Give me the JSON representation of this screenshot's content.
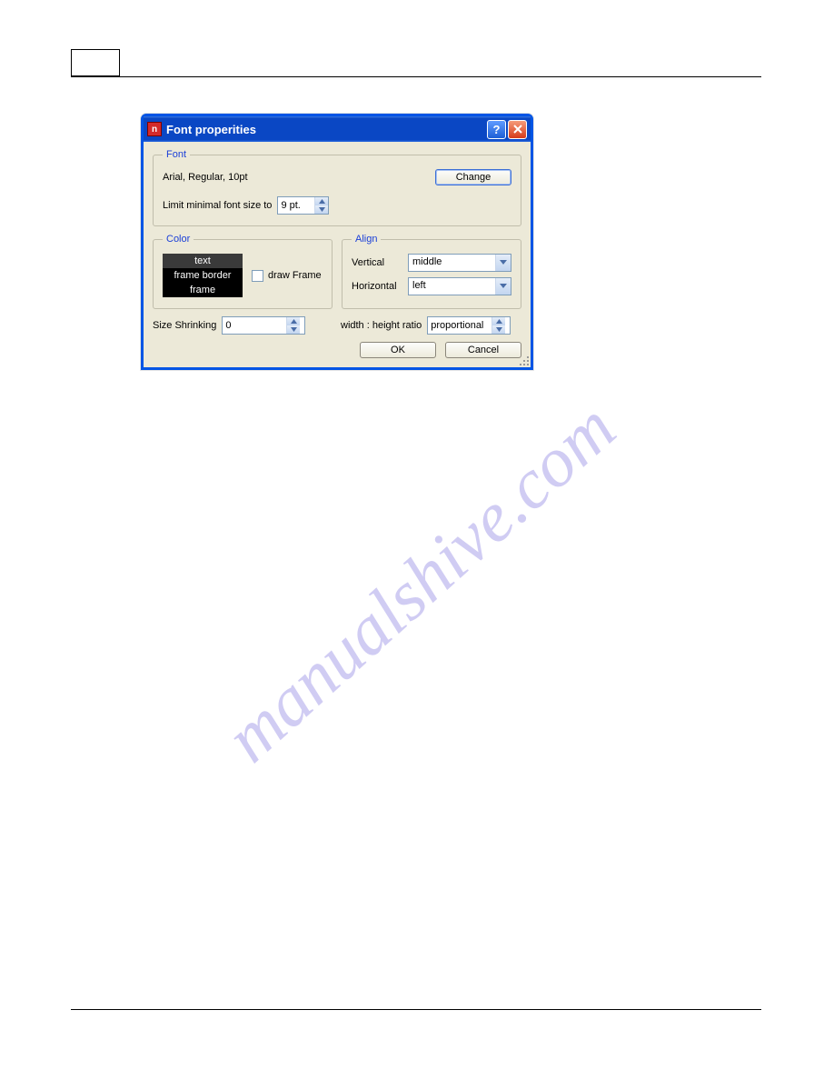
{
  "dialog": {
    "title": "Font properities",
    "font_group": {
      "legend": "Font",
      "current_font": "Arial, Regular, 10pt",
      "change_label": "Change",
      "limit_label": "Limit minimal font size to",
      "limit_value": "9 pt."
    },
    "color_group": {
      "legend": "Color",
      "options": [
        "text",
        "frame border",
        "frame"
      ],
      "draw_frame_label": "draw Frame"
    },
    "align_group": {
      "legend": "Align",
      "vertical_label": "Vertical",
      "vertical_value": "middle",
      "horizontal_label": "Horizontal",
      "horizontal_value": "left"
    },
    "size_shrinking_label": "Size Shrinking",
    "size_shrinking_value": "0",
    "ratio_label": "width : height ratio",
    "ratio_value": "proportional",
    "ok_label": "OK",
    "cancel_label": "Cancel"
  },
  "watermark_text": "manualshive.com"
}
